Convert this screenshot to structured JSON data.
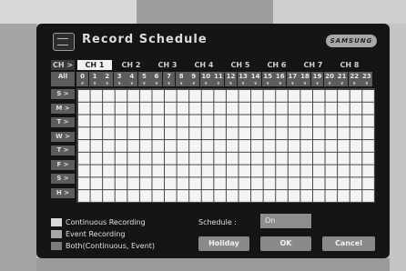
{
  "window": {
    "title": "Record Schedule",
    "brand_logo": "SAMSUNG"
  },
  "channels": {
    "row_header": "CH >",
    "tabs": [
      "CH 1",
      "CH 2",
      "CH 3",
      "CH 4",
      "CH 5",
      "CH 6",
      "CH 7",
      "CH 8"
    ],
    "active_tab": "CH 1"
  },
  "hours": {
    "all_label": "All",
    "values": [
      "0",
      "1",
      "2",
      "3",
      "4",
      "5",
      "6",
      "7",
      "8",
      "9",
      "10",
      "11",
      "12",
      "13",
      "14",
      "15",
      "16",
      "17",
      "18",
      "19",
      "20",
      "21",
      "22",
      "23"
    ]
  },
  "days": [
    "S >",
    "M >",
    "T >",
    "W >",
    "T >",
    "F >",
    "S >",
    "H >"
  ],
  "legend": [
    {
      "label": "Continuous Recording",
      "color": "#d9d9d9"
    },
    {
      "label": "Event Recording",
      "color": "#a8a8a8"
    },
    {
      "label": "Both(Continuous, Event)",
      "color": "#7c7c7c"
    }
  ],
  "schedule": {
    "label": "Schedule :",
    "value": "On"
  },
  "buttons": {
    "holiday": "Holiday",
    "ok": "OK",
    "cancel": "Cancel"
  },
  "colors": {
    "grid_cell": "#f4f4f4",
    "active_tab": "#f2f2f2",
    "frame": "#151515"
  }
}
